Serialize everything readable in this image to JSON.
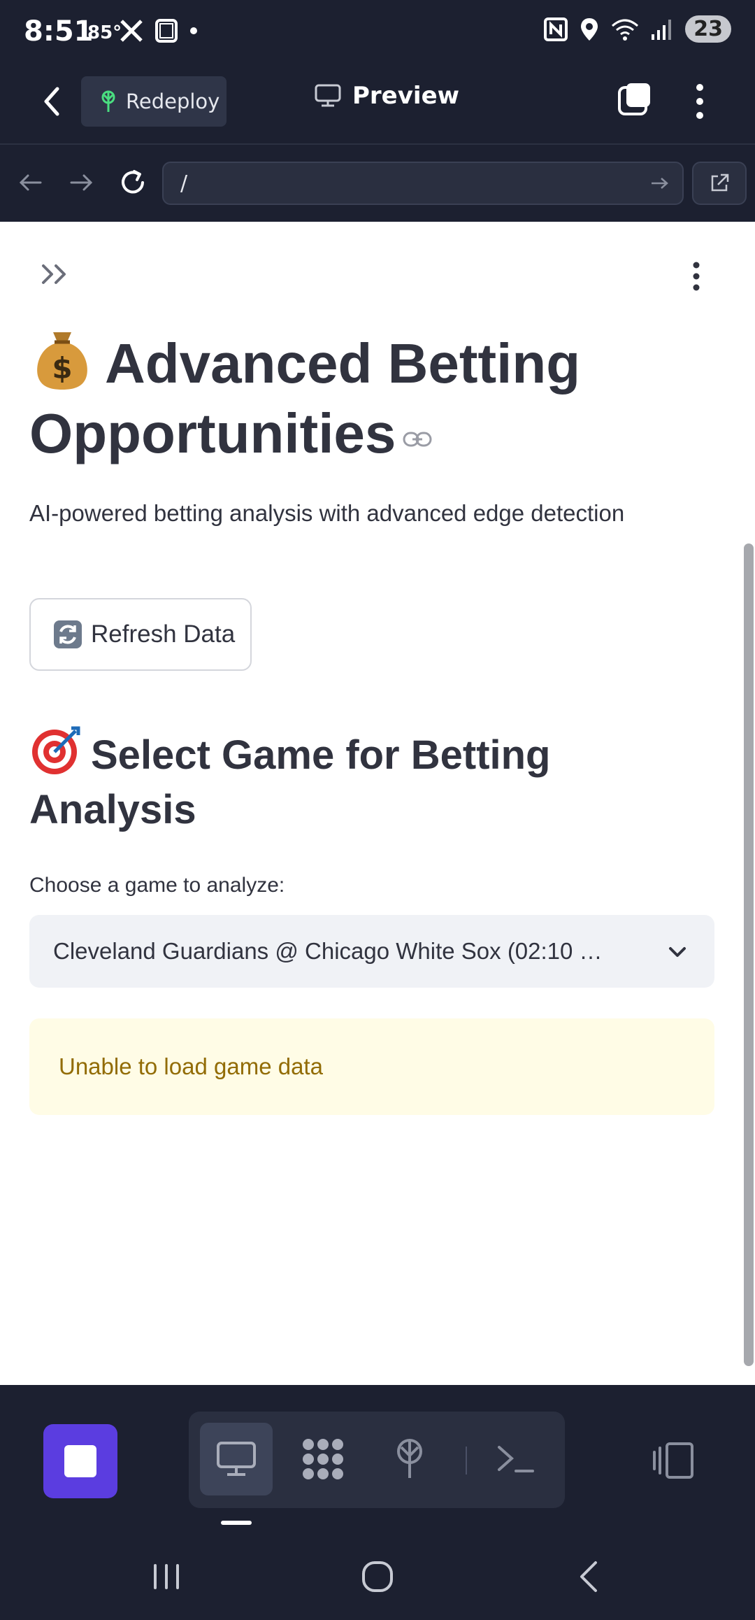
{
  "status_bar": {
    "time": "8:51",
    "temperature": "85°",
    "battery": "23",
    "icons": [
      "x-icon",
      "screen-icon",
      "dot-icon",
      "nfc-icon",
      "location-icon",
      "wifi-icon",
      "signal-icon"
    ]
  },
  "header": {
    "redeploy_label": "Redeploy",
    "title": "Preview"
  },
  "url_bar": {
    "value": "/"
  },
  "main": {
    "title_line1": "Advanced Betting",
    "title_line2": "Opportunities",
    "subtitle": "AI-powered betting analysis with advanced edge detection",
    "refresh_label": "Refresh Data",
    "section_title_line1": "Select Game for Betting",
    "section_title_line2": "Analysis",
    "select_label": "Choose a game to analyze:",
    "select_value": "Cleveland Guardians @ Chicago White Sox (02:10 …",
    "warning": "Unable to load game data"
  },
  "colors": {
    "accent": "#5b3de0",
    "warning_bg": "#fffce6",
    "warning_text": "#926c05",
    "dark_bg": "#1c2030"
  }
}
